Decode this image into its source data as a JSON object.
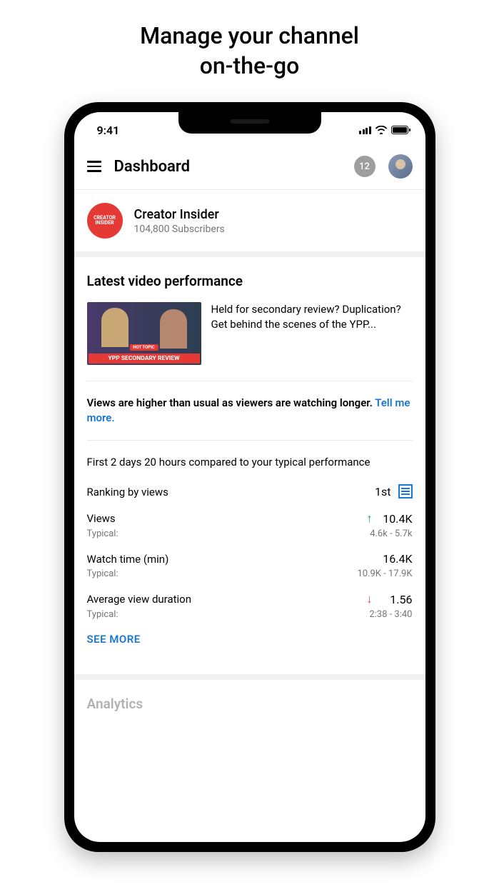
{
  "promo": {
    "line1": "Manage your channel",
    "line2": "on-the-go"
  },
  "status": {
    "time": "9:41"
  },
  "appbar": {
    "title": "Dashboard",
    "notif_count": "12"
  },
  "channel": {
    "name": "Creator Insider",
    "subscribers": "104,800 Subscribers",
    "logo_text": "CREATOR INSIDER"
  },
  "performance": {
    "title": "Latest video performance",
    "video_title": "Held for secondary review? Duplication? Get behind the scenes of the YPP...",
    "thumb_hot_topic": "HOT TOPIC",
    "thumb_banner": "YPP SECONDARY REVIEW",
    "insight_text": "Views are higher than usual as viewers are watching longer. ",
    "insight_link": "Tell me more.",
    "comparison": "First 2 days 20 hours compared to your typical performance",
    "typical_label": "Typical:",
    "ranking": {
      "label": "Ranking by views",
      "value": "1st"
    },
    "views": {
      "label": "Views",
      "value": "10.4K",
      "typical": "4.6k - 5.7k"
    },
    "watch_time": {
      "label": "Watch time (min)",
      "value": "16.4K",
      "typical": "10.9K - 17.9K"
    },
    "avd": {
      "label": "Average view duration",
      "value": "1.56",
      "typical": "2:38 - 3:40"
    },
    "see_more": "SEE MORE"
  },
  "analytics_peek": "Analytics"
}
